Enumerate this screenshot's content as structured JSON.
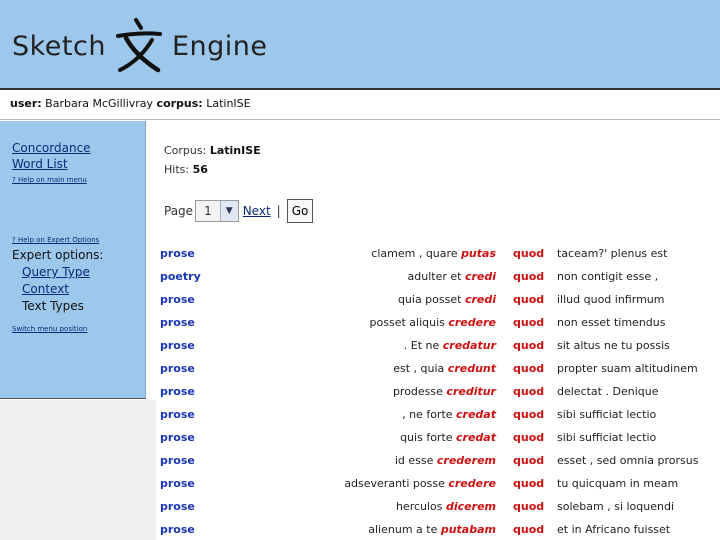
{
  "header": {
    "logo_left": "Sketch",
    "logo_right": "Engine",
    "logo_glyph": "wen-character-glyph"
  },
  "userbar": {
    "user_label": "user:",
    "user_name": "Barbara McGillivray",
    "corpus_label": "corpus:",
    "corpus_name": "LatinISE"
  },
  "sidebar": {
    "concordance": "Concordance",
    "word_list": "Word List",
    "help_main": "? Help on main menu",
    "help_expert": "? Help on Expert Options",
    "expert_label": "Expert options:",
    "query_type": "Query Type",
    "context": "Context",
    "text_types": "Text Types",
    "switch_menu": "Switch menu position"
  },
  "info": {
    "corpus_label": "Corpus:",
    "corpus_value": "LatinISE",
    "hits_label": "Hits:",
    "hits_value": "56"
  },
  "pager": {
    "page_label": "Page",
    "page_value": "1",
    "next_label": "Next",
    "separator": "|",
    "go_label": "Go"
  },
  "rows": [
    {
      "genre": "prose",
      "left": "clamem , quare ",
      "kw": "putas",
      "node": "quod",
      "right": "taceam?' plenus est"
    },
    {
      "genre": "poetry",
      "left": "adulter et ",
      "kw": "credi",
      "node": "quod",
      "right": "non contigit esse ,"
    },
    {
      "genre": "prose",
      "left": "quia posset ",
      "kw": "credi",
      "node": "quod",
      "right": "illud quod infirmum"
    },
    {
      "genre": "prose",
      "left": "posset aliquis ",
      "kw": "credere",
      "node": "quod",
      "right": "non esset timendus"
    },
    {
      "genre": "prose",
      "left": ". Et ne ",
      "kw": "credatur",
      "node": "quod",
      "right": "sit altus ne tu possis"
    },
    {
      "genre": "prose",
      "left": "est , quia ",
      "kw": "credunt",
      "node": "quod",
      "right": "propter suam altitudinem"
    },
    {
      "genre": "prose",
      "left": "prodesse ",
      "kw": "creditur",
      "node": "quod",
      "right": "delectat . Denique"
    },
    {
      "genre": "prose",
      "left": ", ne forte ",
      "kw": "credat",
      "node": "quod",
      "right": "sibi sufficiat lectio"
    },
    {
      "genre": "prose",
      "left": "quis forte ",
      "kw": "credat",
      "node": "quod",
      "right": "sibi sufficiat lectio"
    },
    {
      "genre": "prose",
      "left": "id esse ",
      "kw": "crederem",
      "node": "quod",
      "right": "esset , sed omnia prorsus"
    },
    {
      "genre": "prose",
      "left": "adseveranti posse ",
      "kw": "credere",
      "node": "quod",
      "right": "tu quicquam in meam"
    },
    {
      "genre": "prose",
      "left": "herculos ",
      "kw": "dicerem",
      "node": "quod",
      "right": "solebam , si loquendi"
    },
    {
      "genre": "prose",
      "left": "alienum a te ",
      "kw": "putabam",
      "node": "quod",
      "right": "et in Africano fuisset"
    }
  ]
}
